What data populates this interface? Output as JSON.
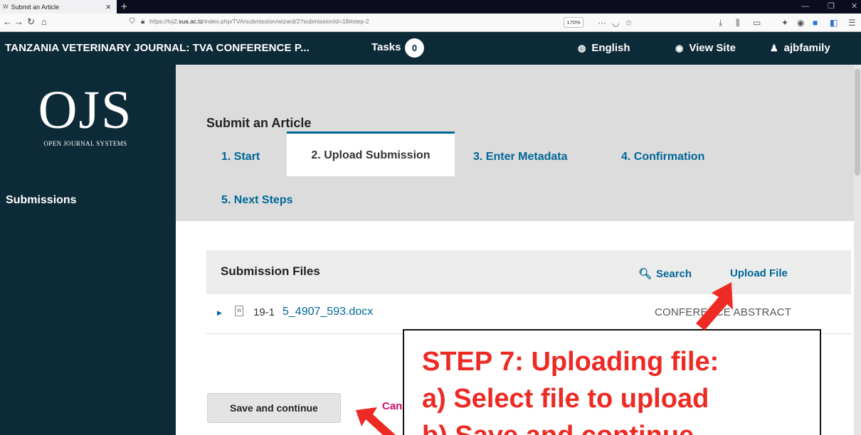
{
  "browser": {
    "tab_title": "Submit an Article",
    "url_prefix": "https://tvj2.",
    "url_domain": "sua.ac.tz",
    "url_path": "/index.php/TVA/submission/wizard/2?submissionId=18#step-2",
    "zoom": "170%"
  },
  "header": {
    "context_title": "TANZANIA VETERINARY JOURNAL: TVA CONFERENCE P...",
    "tasks_label": "Tasks",
    "tasks_count": "0",
    "language": "English",
    "view_site": "View Site",
    "user": "ajbfamily"
  },
  "sidebar": {
    "logo_big": "OJS",
    "logo_small": "OPEN JOURNAL SYSTEMS",
    "items": [
      {
        "label": "Submissions"
      }
    ]
  },
  "main": {
    "title": "Submit an Article",
    "tabs": [
      {
        "label": "1. Start"
      },
      {
        "label": "2. Upload Submission"
      },
      {
        "label": "3. Enter Metadata"
      },
      {
        "label": "4. Confirmation"
      },
      {
        "label": "5. Next Steps"
      }
    ],
    "active_tab": 1,
    "files": {
      "title": "Submission Files",
      "search_label": "Search",
      "upload_label": "Upload File",
      "rows": [
        {
          "id": "19-1",
          "name": "5_4907_593.docx",
          "genre": "CONFERENCE ABSTRACT",
          "icon": "W"
        }
      ]
    },
    "save_label": "Save and continue",
    "cancel_label": "Cancel"
  },
  "annotation": {
    "lines": [
      "STEP 7: Uploading file:",
      "a) Select file to upload",
      "b) Save and continue"
    ],
    "color": "#ee2a24"
  },
  "colors": {
    "header_bg": "#0d2a38",
    "link": "#006798",
    "cancel": "#d00b6a"
  }
}
